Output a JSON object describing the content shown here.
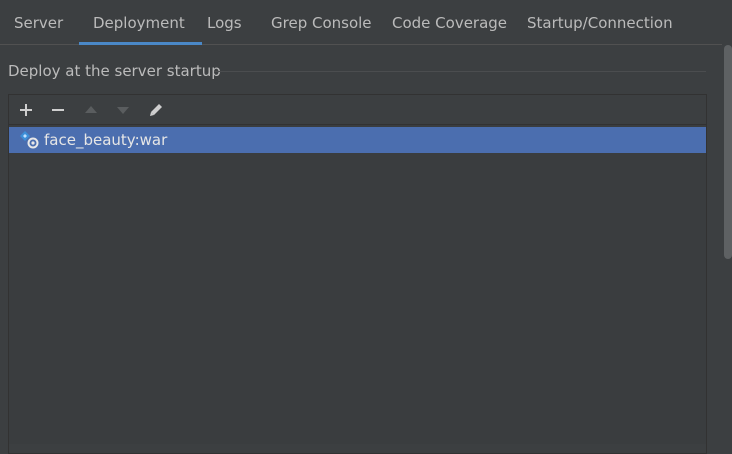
{
  "tabs": [
    {
      "label": "Server"
    },
    {
      "label": "Deployment",
      "active": true
    },
    {
      "label": "Logs"
    },
    {
      "label": "Grep Console"
    },
    {
      "label": "Code Coverage"
    },
    {
      "label": "Startup/Connection"
    }
  ],
  "deploy_group": {
    "title": "Deploy at the server startup"
  },
  "toolbar": {
    "buttons": [
      {
        "icon": "plus-icon",
        "enabled": true
      },
      {
        "icon": "minus-icon",
        "enabled": true
      },
      {
        "icon": "arrow-up-icon",
        "enabled": false
      },
      {
        "icon": "arrow-down-icon",
        "enabled": false
      },
      {
        "icon": "pencil-icon",
        "enabled": true
      }
    ]
  },
  "artifacts": [
    {
      "name": "face_beauty:war",
      "icon": "artifact-icon",
      "selected": true
    }
  ],
  "colors": {
    "background": "#3c3f41",
    "selection": "#4b6eaf",
    "tab_underline": "#4a88c7"
  }
}
